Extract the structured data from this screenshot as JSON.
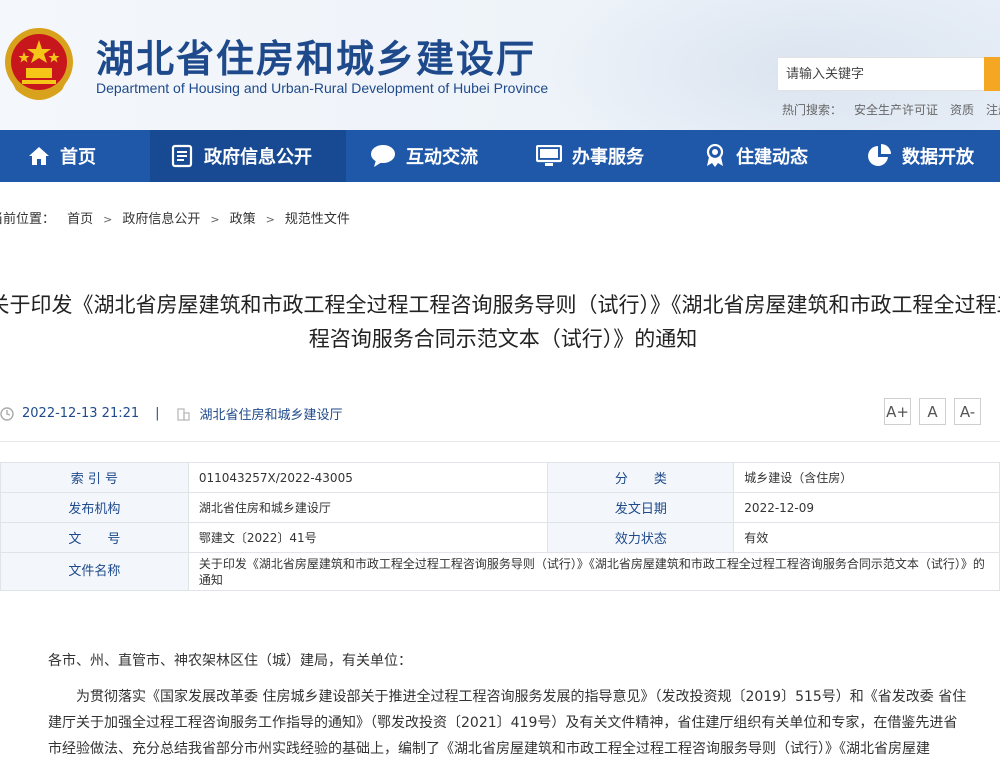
{
  "header": {
    "title": "湖北省住房和城乡建设厅",
    "subtitle": "Department of Housing and Urban-Rural Development of Hubei Province",
    "search_placeholder": "请输入关键字",
    "hot_search_label": "热门搜索：",
    "hot_search_items": [
      "安全生产许可证",
      "资质",
      "注册"
    ]
  },
  "nav": {
    "items": [
      {
        "label": "首页",
        "icon": "home-icon"
      },
      {
        "label": "政府信息公开",
        "icon": "document-icon"
      },
      {
        "label": "互动交流",
        "icon": "chat-icon"
      },
      {
        "label": "办事服务",
        "icon": "monitor-icon"
      },
      {
        "label": "住建动态",
        "icon": "medal-icon"
      },
      {
        "label": "数据开放",
        "icon": "pie-chart-icon"
      }
    ]
  },
  "breadcrumb": {
    "label": "当前位置：",
    "items": [
      "首页",
      "政府信息公开",
      "政策",
      "规范性文件"
    ]
  },
  "article": {
    "title_line1": "关于印发《湖北省房屋建筑和市政工程全过程工程咨询服务导则（试行）》《湖北省房屋建筑和市政工程全过程工",
    "title_line2": "程咨询服务合同示范文本（试行）》的通知",
    "date": "2022-12-13 21:21",
    "source": "湖北省住房和城乡建设厅",
    "font_buttons": [
      "A+",
      "A",
      "A-"
    ]
  },
  "info_table": {
    "index_label": "索 引 号",
    "index_value": "011043257X/2022-43005",
    "category_label": "分　　类",
    "category_value": "城乡建设（含住房）",
    "issuer_label": "发布机构",
    "issuer_value": "湖北省住房和城乡建设厅",
    "date_label": "发文日期",
    "date_value": "2022-12-09",
    "docno_label": "文　　号",
    "docno_value": "鄂建文〔2022〕41号",
    "status_label": "效力状态",
    "status_value": "有效",
    "filename_label": "文件名称",
    "filename_value": "关于印发《湖北省房屋建筑和市政工程全过程工程咨询服务导则（试行）》《湖北省房屋建筑和市政工程全过程工程咨询服务合同示范文本（试行）》的通知"
  },
  "body": {
    "salutation": "各市、州、直管市、神农架林区住（城）建局，有关单位：",
    "para1": "为贯彻落实《国家发展改革委 住房城乡建设部关于推进全过程工程咨询服务发展的指导意见》（发改投资规〔2019〕515号）和《省发改委 省住建厅关于加强全过程工程咨询服务工作指导的通知》（鄂发改投资〔2021〕419号）及有关文件精神，省住建厅组织有关单位和专家，在借鉴先进省市经验做法、充分总结我省部分市州实践经验的基础上，编制了《湖北省房屋建筑和市政工程全过程工程咨询服务导则（试行）》《湖北省房屋建"
  },
  "colors": {
    "brand_blue": "#1f58a8",
    "accent": "#f5a623"
  }
}
